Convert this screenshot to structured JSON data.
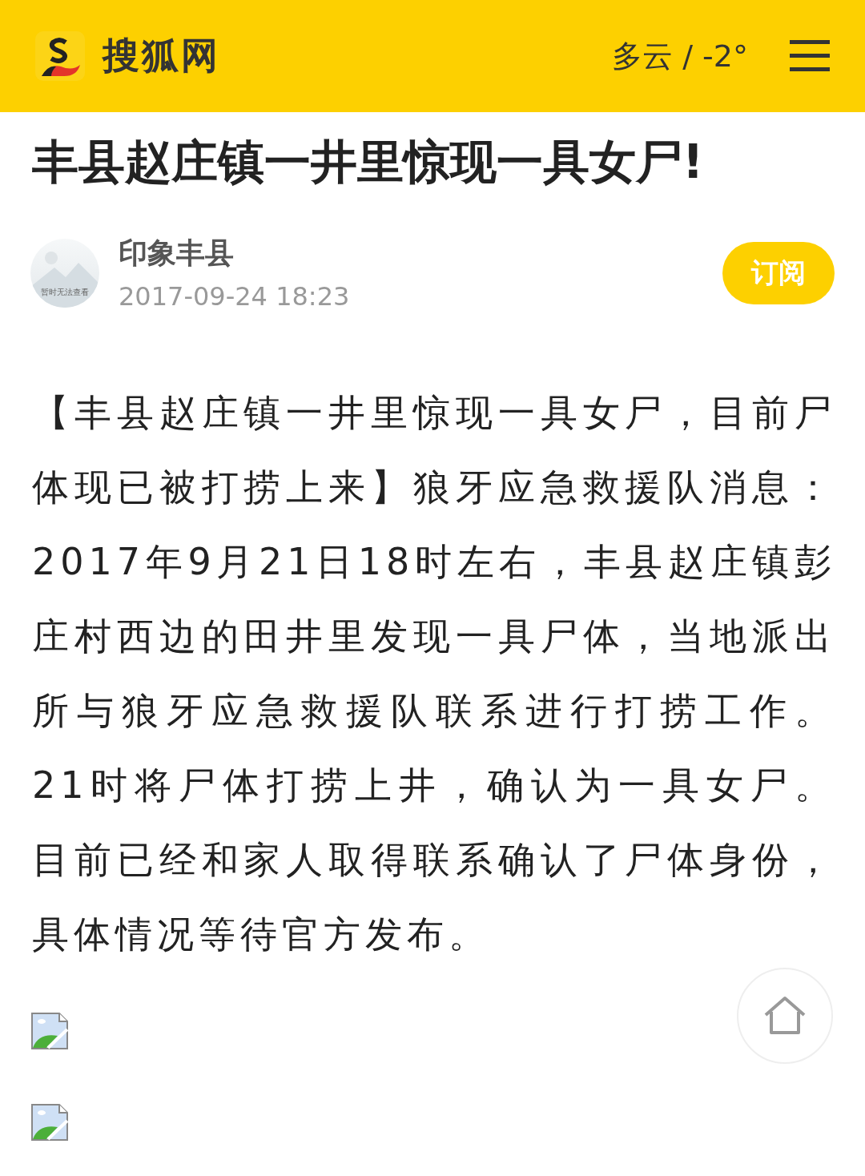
{
  "header": {
    "site_name": "搜狐网",
    "weather": "多云 / -2°"
  },
  "article": {
    "title": "丰县赵庄镇一井里惊现一具女尸!",
    "author": {
      "name": "印象丰县",
      "date": "2017-09-24 18:23",
      "avatar_caption": "暂时无法查看"
    },
    "subscribe_button": "订阅",
    "body": "【丰县赵庄镇一井里惊现一具女尸，目前尸体现已被打捞上来】狼牙应急救援队消息：2017年9月21日18时左右，丰县赵庄镇彭庄村西边的田井里发现一具尸体，当地派出所与狼牙应急救援队联系进行打捞工作。21时将尸体打捞上井，确认为一具女尸。目前已经和家人取得联系确认了尸体身份，具体情况等待官方发布。",
    "images": [
      {
        "kind": "broken"
      },
      {
        "kind": "broken"
      }
    ]
  }
}
